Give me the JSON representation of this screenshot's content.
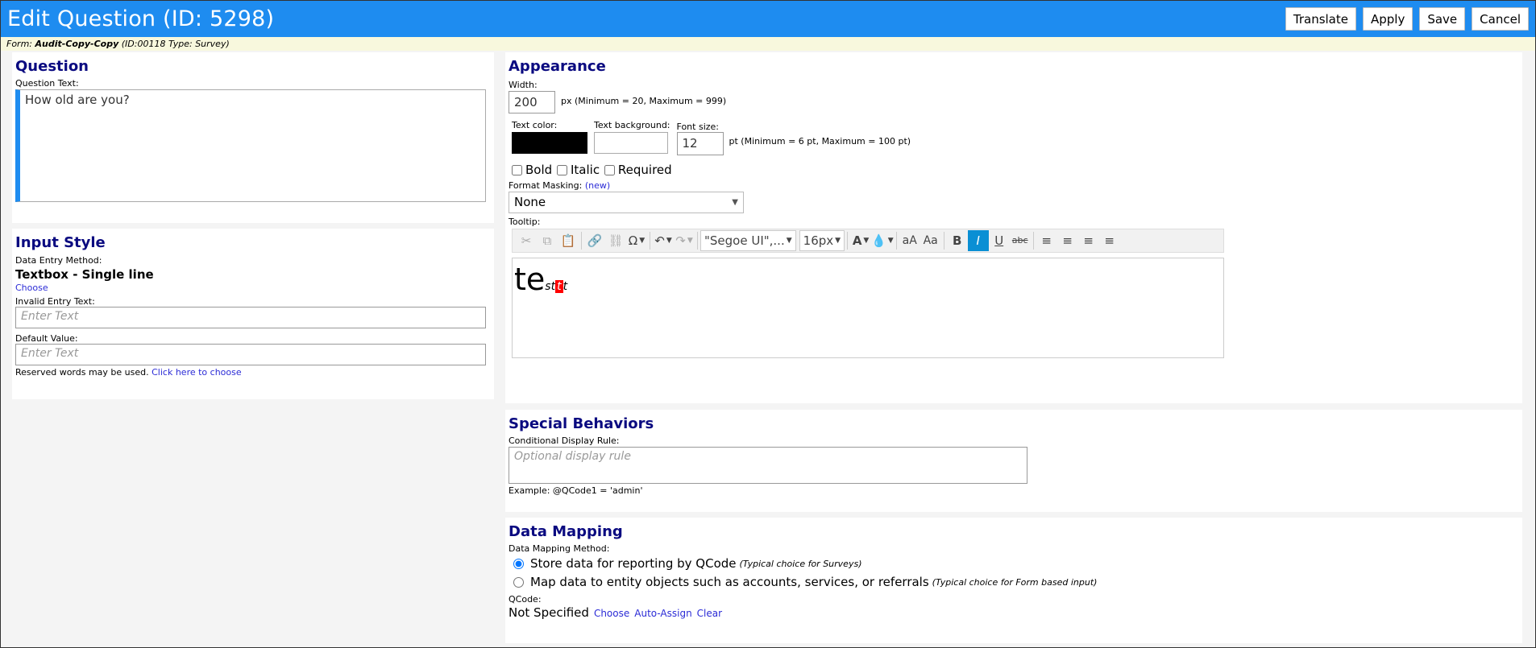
{
  "header": {
    "title": "Edit Question (ID: 5298)",
    "buttons": {
      "translate": "Translate",
      "apply": "Apply",
      "save": "Save",
      "cancel": "Cancel"
    }
  },
  "formbar": {
    "prefix": "Form:",
    "form_name": "Audit-Copy-Copy",
    "form_id": "(ID:00118",
    "type": "Type: Survey)"
  },
  "question": {
    "title": "Question",
    "text_label": "Question Text:",
    "text_value": "How old are you?"
  },
  "input_style": {
    "title": "Input Style",
    "method_label": "Data Entry Method:",
    "method_value": "Textbox - Single line",
    "choose": "Choose",
    "invalid_label": "Invalid Entry Text:",
    "invalid_placeholder": "Enter Text",
    "default_label": "Default Value:",
    "default_placeholder": "Enter Text",
    "reserved_text": "Reserved words may be used.",
    "reserved_link": "Click here to choose"
  },
  "appearance": {
    "title": "Appearance",
    "width_label": "Width:",
    "width_value": "200",
    "width_hint": "px (Minimum = 20, Maximum = 999)",
    "text_color_label": "Text color:",
    "text_bg_label": "Text background:",
    "font_size_label": "Font size:",
    "font_size_value": "12",
    "font_size_hint": "pt (Minimum = 6 pt, Maximum = 100 pt)",
    "bold": "Bold",
    "italic": "Italic",
    "required": "Required",
    "masking_label": "Format Masking:",
    "masking_new": "(new)",
    "masking_value": "None",
    "tooltip_label": "Tooltip:",
    "font_family": "\"Segoe UI\",...",
    "font_px": "16px",
    "aa_lower": "aA",
    "aa_upper": "Aa",
    "tip_big": "te",
    "tip_small_a": "st",
    "tip_small_b": "t",
    "tip_small_c": "t",
    "colors": {
      "text_color": "#000000",
      "text_background": "#ffffff",
      "highlight": "#ff0000"
    }
  },
  "special": {
    "title": "Special Behaviors",
    "rule_label": "Conditional Display Rule:",
    "rule_placeholder": "Optional display rule",
    "example": "Example: @QCode1 = 'admin'"
  },
  "mapping": {
    "title": "Data Mapping",
    "method_label": "Data Mapping Method:",
    "opt1": "Store data for reporting by QCode",
    "opt1_hint": "(Typical choice for Surveys)",
    "opt2": "Map data to entity objects such as accounts, services, or referrals",
    "opt2_hint": "(Typical choice for Form based input)",
    "qcode_label": "QCode:",
    "qcode_value": "Not Specified",
    "choose": "Choose",
    "auto_assign": "Auto-Assign",
    "clear": "Clear"
  },
  "accent": "#1e8cf0"
}
